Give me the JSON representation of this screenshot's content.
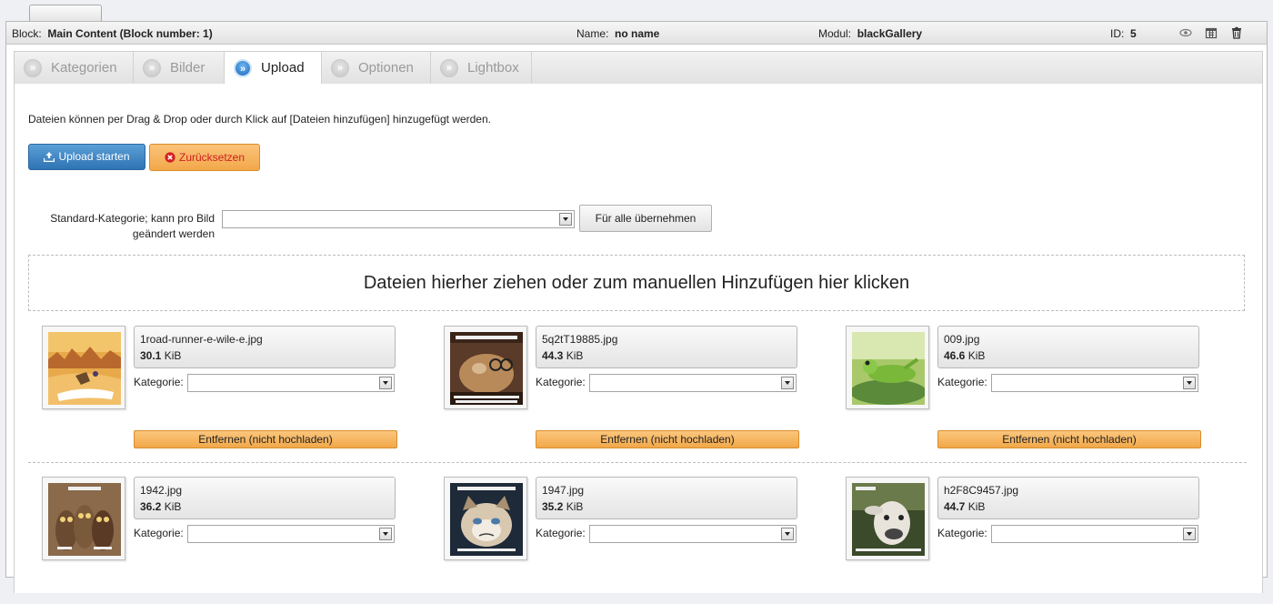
{
  "block_header": {
    "block_label": "Block:",
    "block_value": "Main Content (Block number: 1)",
    "name_label": "Name:",
    "name_value": "no name",
    "modul_label": "Modul:",
    "modul_value": "blackGallery",
    "id_label": "ID:",
    "id_value": "5",
    "icons": [
      "eye-icon",
      "calendar-icon",
      "trash-icon"
    ]
  },
  "tabs": [
    {
      "label": "Kategorien",
      "active": false
    },
    {
      "label": "Bilder",
      "active": false
    },
    {
      "label": "Upload",
      "active": true
    },
    {
      "label": "Optionen",
      "active": false
    },
    {
      "label": "Lightbox",
      "active": false
    }
  ],
  "tab_bullet": "»",
  "upload": {
    "hint": "Dateien können per Drag & Drop oder durch Klick auf [Dateien hinzufügen] hinzugefügt werden.",
    "start_label": "Upload starten",
    "reset_label": "Zurücksetzen",
    "std_category_label": "Standard-Kategorie; kann pro Bild geändert werden",
    "std_category_value": "",
    "apply_all_label": "Für alle übernehmen",
    "dropzone_text": "Dateien hierher ziehen oder zum manuellen Hinzufügen hier klicken",
    "kategorie_label": "Kategorie:",
    "remove_label": "Entfernen (nicht hochladen)",
    "files": [
      {
        "name": "1road-runner-e-wile-e.jpg",
        "size_num": "30.1",
        "size_unit": "KiB",
        "category": ""
      },
      {
        "name": "5q2tT19885.jpg",
        "size_num": "44.3",
        "size_unit": "KiB",
        "category": ""
      },
      {
        "name": "009.jpg",
        "size_num": "46.6",
        "size_unit": "KiB",
        "category": ""
      },
      {
        "name": "1942.jpg",
        "size_num": "36.2",
        "size_unit": "KiB",
        "category": ""
      },
      {
        "name": "1947.jpg",
        "size_num": "35.2",
        "size_unit": "KiB",
        "category": ""
      },
      {
        "name": "h2F8C9457.jpg",
        "size_num": "44.7",
        "size_unit": "KiB",
        "category": ""
      }
    ]
  },
  "colors": {
    "primary_button": "#3a85c5",
    "warning_button": "#f5b35e",
    "reset_text": "#cc2222"
  }
}
